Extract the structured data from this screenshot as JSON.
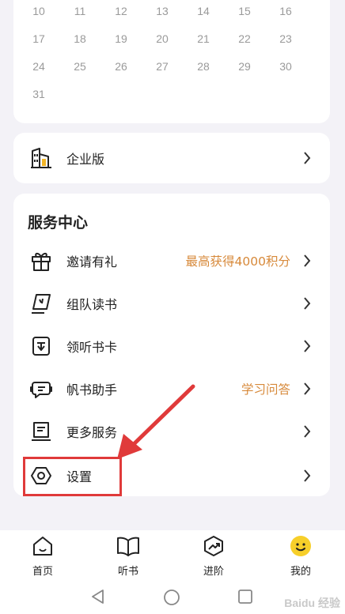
{
  "calendar": {
    "rows": [
      [
        "10",
        "11",
        "12",
        "13",
        "14",
        "15",
        "16"
      ],
      [
        "17",
        "18",
        "19",
        "20",
        "21",
        "22",
        "23"
      ],
      [
        "24",
        "25",
        "26",
        "27",
        "28",
        "29",
        "30"
      ],
      [
        "31"
      ]
    ]
  },
  "enterprise": {
    "label": "企业版",
    "icon": "building-icon"
  },
  "services": {
    "title": "服务中心",
    "items": [
      {
        "label": "邀请有礼",
        "extra": "最高获得4000积分",
        "icon": "gift-icon"
      },
      {
        "label": "组队读书",
        "extra": "",
        "icon": "flag-icon"
      },
      {
        "label": "领听书卡",
        "extra": "",
        "icon": "card-icon"
      },
      {
        "label": "帆书助手",
        "extra": "学习问答",
        "icon": "assistant-icon"
      },
      {
        "label": "更多服务",
        "extra": "",
        "icon": "book-open-icon"
      },
      {
        "label": "设置",
        "extra": "",
        "icon": "settings-icon"
      }
    ]
  },
  "tabs": [
    {
      "label": "首页",
      "icon": "home-icon"
    },
    {
      "label": "听书",
      "icon": "book-icon"
    },
    {
      "label": "进阶",
      "icon": "trend-icon"
    },
    {
      "label": "我的",
      "icon": "smiley-icon"
    }
  ],
  "colors": {
    "accent": "#d7893a",
    "highlight": "#e03a3a",
    "smiley": "#f7cf2a"
  },
  "watermark": "Baidu 经验"
}
